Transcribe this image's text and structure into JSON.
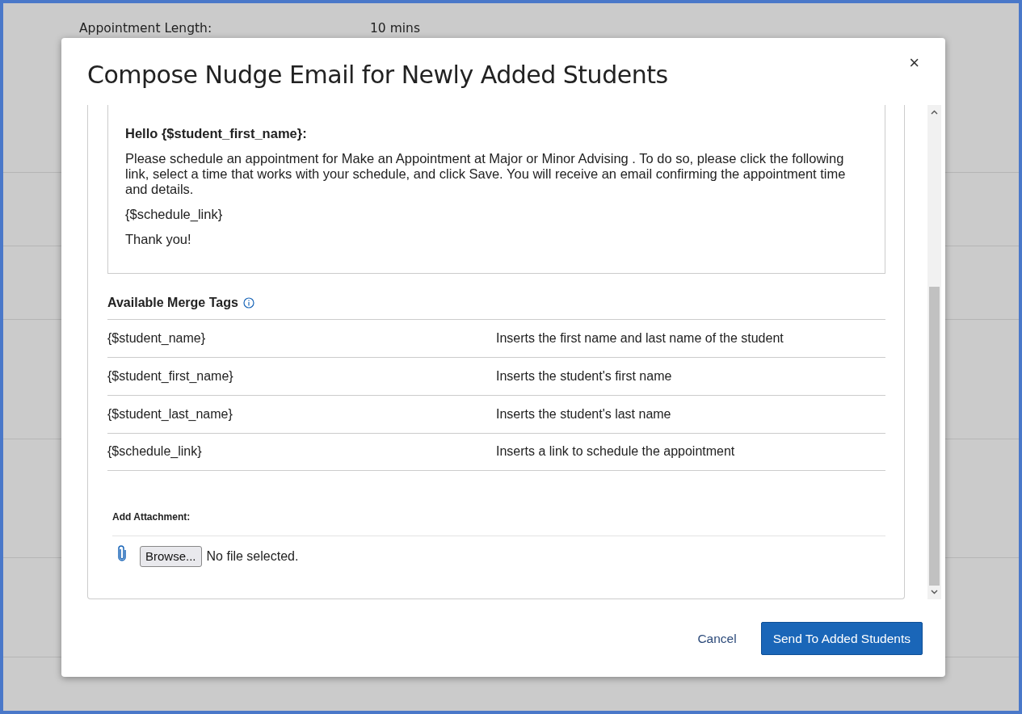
{
  "background": {
    "rows": [
      {
        "label": "Appointment Length:",
        "value": "10 mins"
      }
    ]
  },
  "modal": {
    "title": "Compose Nudge Email for Newly Added Students",
    "close": "×",
    "email": {
      "greeting": "Hello {$student_first_name}:",
      "paragraphs": [
        "Please schedule an appointment for Make an Appointment at Major or Minor Advising . To do so, please click the following link, select a time that works with your schedule, and click Save. You will receive an email confirming the appointment time and details.",
        "{$schedule_link}",
        "Thank you!"
      ]
    },
    "merge_tags": {
      "title": "Available Merge Tags",
      "rows": [
        {
          "tag": "{$student_name}",
          "description": "Inserts the first name and last name of the student"
        },
        {
          "tag": "{$student_first_name}",
          "description": "Inserts the student's first name"
        },
        {
          "tag": "{$student_last_name}",
          "description": "Inserts the student's last name"
        },
        {
          "tag": "{$schedule_link}",
          "description": "Inserts a link to schedule the appointment"
        }
      ]
    },
    "attachment": {
      "label": "Add Attachment:",
      "browse": "Browse...",
      "status": "No file selected."
    },
    "buttons": [
      {
        "label": "Cancel",
        "kind": "link"
      },
      {
        "label": "Send To Added Students",
        "kind": "primary"
      }
    ]
  }
}
